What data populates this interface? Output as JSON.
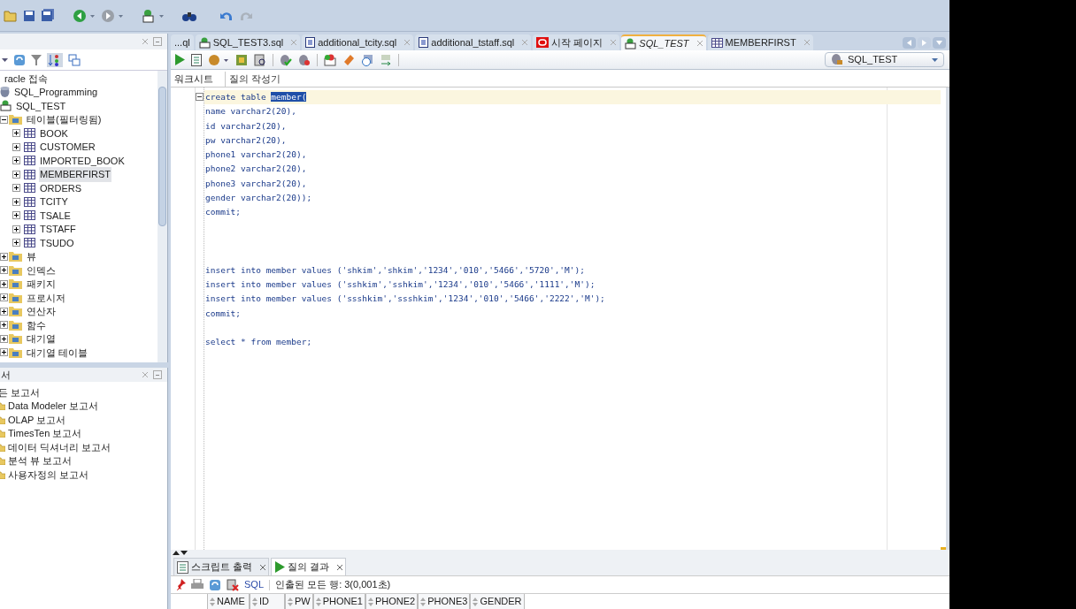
{
  "navigator": {
    "tree": [
      {
        "label": "racle 접속",
        "selected": false,
        "children": [
          {
            "label": "SQL_Programming",
            "kind": "db",
            "selected": false
          },
          {
            "label": "SQL_TEST",
            "kind": "sql",
            "selected": false,
            "children": [
              {
                "label": "테이블(필터링됨)",
                "kind": "folder",
                "selected": false,
                "expanded": true,
                "children": [
                  {
                    "label": "BOOK",
                    "kind": "table",
                    "selected": false,
                    "expanded": false
                  },
                  {
                    "label": "CUSTOMER",
                    "kind": "table",
                    "selected": false,
                    "expanded": false
                  },
                  {
                    "label": "IMPORTED_BOOK",
                    "kind": "table",
                    "selected": false,
                    "expanded": false
                  },
                  {
                    "label": "MEMBERFIRST",
                    "kind": "table",
                    "selected": true,
                    "expanded": false
                  },
                  {
                    "label": "ORDERS",
                    "kind": "table",
                    "selected": false,
                    "expanded": false
                  },
                  {
                    "label": "TCITY",
                    "kind": "table",
                    "selected": false,
                    "expanded": false
                  },
                  {
                    "label": "TSALE",
                    "kind": "table",
                    "selected": false,
                    "expanded": false
                  },
                  {
                    "label": "TSTAFF",
                    "kind": "table",
                    "selected": false,
                    "expanded": false
                  },
                  {
                    "label": "TSUDO",
                    "kind": "table",
                    "selected": false,
                    "expanded": false
                  }
                ]
              },
              {
                "label": "뷰",
                "kind": "folder",
                "selected": false,
                "expanded": false
              },
              {
                "label": "인덱스",
                "kind": "folder",
                "selected": false,
                "expanded": false
              },
              {
                "label": "패키지",
                "kind": "folder",
                "selected": false,
                "expanded": false
              },
              {
                "label": "프로시저",
                "kind": "folder",
                "selected": false,
                "expanded": false
              },
              {
                "label": "연산자",
                "kind": "folder",
                "selected": false,
                "expanded": false
              },
              {
                "label": "함수",
                "kind": "folder",
                "selected": false,
                "expanded": false
              },
              {
                "label": "대기열",
                "kind": "folder",
                "selected": false,
                "expanded": false
              },
              {
                "label": "대기열 테이블",
                "kind": "folder",
                "selected": false,
                "expanded": false
              }
            ]
          }
        ]
      }
    ]
  },
  "reports": {
    "title": "서",
    "items": [
      {
        "label": "든 보고서",
        "children": [
          {
            "label": "Data Modeler 보고서"
          },
          {
            "label": "OLAP 보고서"
          },
          {
            "label": "TimesTen 보고서"
          },
          {
            "label": "데이터 딕셔너리 보고서"
          },
          {
            "label": "분석 뷰 보고서"
          },
          {
            "label": "사용자정의 보고서"
          }
        ]
      }
    ]
  },
  "editor_tabs": [
    {
      "label": "...ql",
      "selected": false
    },
    {
      "label": "SQL_TEST3.sql",
      "kind": "sql",
      "selected": false
    },
    {
      "label": "additional_tcity.sql",
      "kind": "file",
      "selected": false
    },
    {
      "label": "additional_tstaff.sql",
      "kind": "file",
      "selected": false
    },
    {
      "label": "시작 페이지",
      "kind": "oracle",
      "selected": false
    },
    {
      "label": "SQL_TEST",
      "kind": "sql",
      "selected": true
    },
    {
      "label": "MEMBERFIRST",
      "kind": "table",
      "selected": false
    }
  ],
  "connection": "SQL_TEST",
  "sub_tabs": [
    {
      "label": "워크시트",
      "selected": true
    },
    {
      "label": "질의 작성기",
      "selected": false
    }
  ],
  "code": {
    "blocks": [
      [
        {
          "text": "create table ",
          "selection": "member("
        },
        {
          "text": "name varchar2(20),"
        },
        {
          "text": "id varchar2(20),"
        },
        {
          "text": "pw varchar2(20),"
        },
        {
          "text": "phone1 varchar2(20),"
        },
        {
          "text": "phone2 varchar2(20),"
        },
        {
          "text": "phone3 varchar2(20),"
        },
        {
          "text": "gender varchar2(20));"
        },
        {
          "text": "commit;"
        }
      ],
      [
        {
          "text": "insert into member values ('shkim','shkim','1234','010','5466','5720','M');"
        },
        {
          "text": "insert into member values ('sshkim','sshkim','1234','010','5466','1111','M');"
        },
        {
          "text": "insert into member values ('ssshkim','ssshkim','1234','010','5466','2222','M');"
        },
        {
          "text": "commit;"
        }
      ],
      [
        {
          "text": "select * from member;"
        }
      ]
    ]
  },
  "output_tabs": [
    {
      "label": "스크립트 출력",
      "kind": "doc",
      "selected": false
    },
    {
      "label": "질의 결과",
      "kind": "play",
      "selected": true
    }
  ],
  "result_bar": {
    "sql_link": "SQL",
    "status": "인출된 모든 행: 3(0,001초)"
  },
  "result_table": {
    "columns": [
      "NAME",
      "ID",
      "PW",
      "PHONE1",
      "PHONE2",
      "PHONE3",
      "GENDER"
    ]
  }
}
